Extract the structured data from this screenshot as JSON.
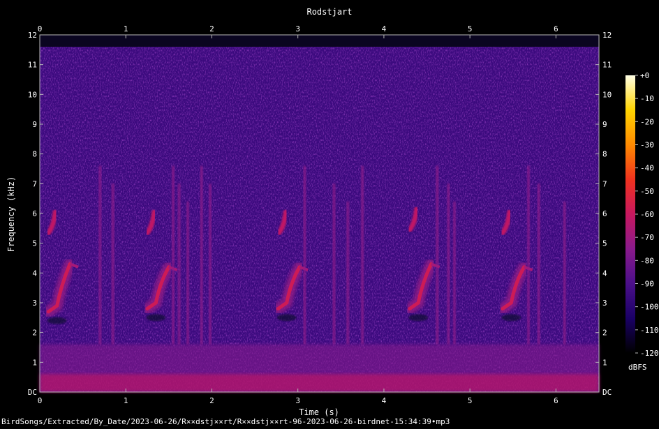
{
  "chart_data": {
    "type": "heatmap",
    "title": "Rodstjart",
    "xlabel": "Time (s)",
    "ylabel": "Frequency (kHz)",
    "xlim": [
      0,
      6.5
    ],
    "ylim": [
      0,
      12
    ],
    "x_ticks": [
      "0",
      "1",
      "2",
      "3",
      "4",
      "5",
      "6"
    ],
    "y_ticks": [
      "DC",
      "1",
      "2",
      "3",
      "4",
      "5",
      "6",
      "7",
      "8",
      "9",
      "10",
      "11",
      "12"
    ],
    "colorbar": {
      "label": "dBFS",
      "ticks": [
        "+0",
        "-10",
        "-20",
        "-30",
        "-40",
        "-50",
        "-60",
        "-70",
        "-80",
        "-90",
        "-100",
        "-110",
        "-120"
      ],
      "range": [
        -120,
        0
      ],
      "colormap": [
        "#000000",
        "#1a0066",
        "#4b0f8a",
        "#8a1a8c",
        "#c8185f",
        "#f0321e",
        "#ff8a00",
        "#ffd400",
        "#ffffe6"
      ]
    },
    "background_level_dbfs": -95,
    "content_upper_limit_khz": 11.6,
    "song_phrases": [
      {
        "start_s": 0.1,
        "note1_khz": 5.5,
        "sweep_start_s": 0.2,
        "sweep_end_s": 0.35,
        "sweep_low_khz": 2.7,
        "sweep_high_khz": 4.3,
        "clicks_s": [
          0.7,
          0.85
        ]
      },
      {
        "start_s": 1.25,
        "note1_khz": 5.5,
        "sweep_start_s": 1.35,
        "sweep_end_s": 1.5,
        "sweep_low_khz": 2.8,
        "sweep_high_khz": 4.2,
        "clicks_s": [
          1.55,
          1.62,
          1.72,
          1.88,
          1.98
        ]
      },
      {
        "start_s": 2.78,
        "note1_khz": 5.5,
        "sweep_start_s": 2.87,
        "sweep_end_s": 3.02,
        "sweep_low_khz": 2.8,
        "sweep_high_khz": 4.2,
        "clicks_s": [
          3.08,
          3.42,
          3.58,
          3.75
        ]
      },
      {
        "start_s": 4.3,
        "note1_khz": 5.6,
        "sweep_start_s": 4.4,
        "sweep_end_s": 4.55,
        "sweep_low_khz": 2.8,
        "sweep_high_khz": 4.3,
        "clicks_s": [
          4.62,
          4.75,
          4.82
        ]
      },
      {
        "start_s": 5.38,
        "note1_khz": 5.5,
        "sweep_start_s": 5.48,
        "sweep_end_s": 5.63,
        "sweep_low_khz": 2.8,
        "sweep_high_khz": 4.2,
        "clicks_s": [
          5.68,
          5.8,
          6.1
        ]
      }
    ]
  },
  "footer": {
    "filename": "BirdSongs/Extracted/By_Date/2023-06-26/R××dstj××rt/R××dstj××rt-96-2023-06-26-birdnet-15:34:39•mp3"
  }
}
